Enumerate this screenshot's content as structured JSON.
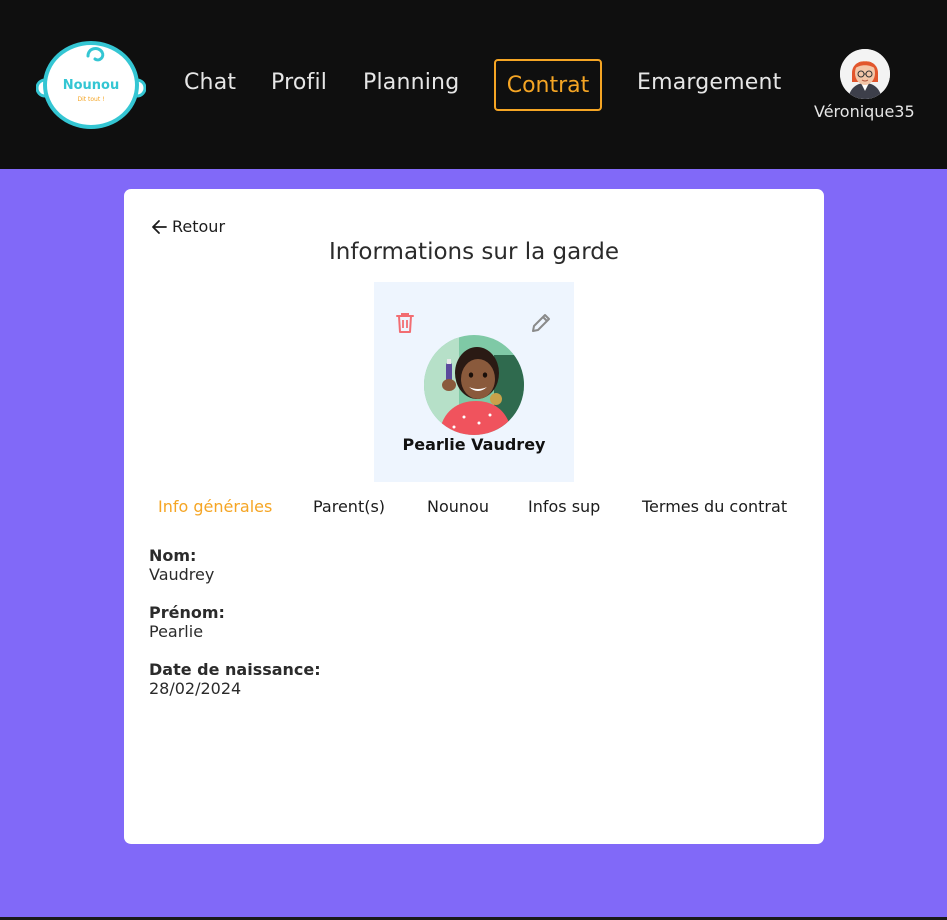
{
  "header": {
    "logo": {
      "text": "Nounou",
      "tagline": "Dit tout !"
    },
    "nav": [
      {
        "label": "Chat"
      },
      {
        "label": "Profil"
      },
      {
        "label": "Planning"
      },
      {
        "label": "Contrat"
      },
      {
        "label": "Emargement"
      }
    ],
    "user": {
      "name": "Véronique35",
      "icon": "user-avatar"
    }
  },
  "card": {
    "back_label": "Retour",
    "title": "Informations sur la garde",
    "child": {
      "name": "Pearlie Vaudrey"
    },
    "tabs": [
      {
        "label": "Info générales",
        "active": true
      },
      {
        "label": "Parent(s)"
      },
      {
        "label": "Nounou"
      },
      {
        "label": "Infos sup"
      },
      {
        "label": "Termes du contrat"
      }
    ],
    "fields": [
      {
        "label": "Nom:",
        "value": "Vaudrey"
      },
      {
        "label": "Prénom:",
        "value": "Pearlie"
      },
      {
        "label": "Date de naissance:",
        "value": "28/02/2024"
      }
    ]
  },
  "colors": {
    "background": "#8169f8",
    "header": "#0f0f0f",
    "accent": "#f5a524",
    "delete": "#f26d72",
    "edit": "#8a8a8a"
  }
}
